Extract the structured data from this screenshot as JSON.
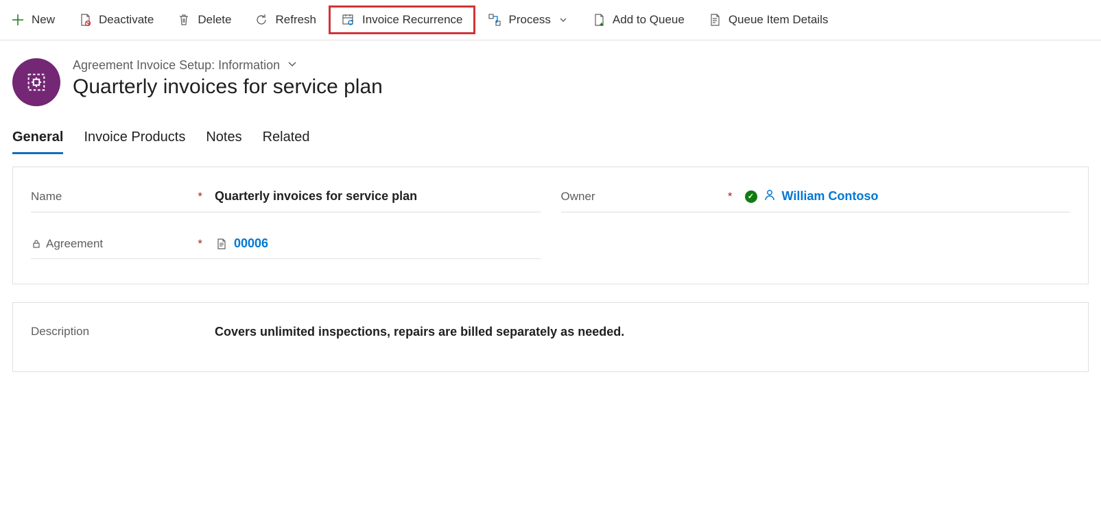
{
  "commandBar": {
    "new": "New",
    "deactivate": "Deactivate",
    "delete": "Delete",
    "refresh": "Refresh",
    "invoiceRecurrence": "Invoice Recurrence",
    "process": "Process",
    "addToQueue": "Add to Queue",
    "queueItemDetails": "Queue Item Details"
  },
  "header": {
    "formSelector": "Agreement Invoice Setup: Information",
    "title": "Quarterly invoices for service plan"
  },
  "tabs": {
    "general": "General",
    "invoiceProducts": "Invoice Products",
    "notes": "Notes",
    "related": "Related"
  },
  "fields": {
    "nameLabel": "Name",
    "nameValue": "Quarterly invoices for service plan",
    "ownerLabel": "Owner",
    "ownerValue": "William Contoso",
    "agreementLabel": "Agreement",
    "agreementValue": "00006",
    "descriptionLabel": "Description",
    "descriptionValue": "Covers unlimited inspections, repairs are billed separately as needed."
  }
}
